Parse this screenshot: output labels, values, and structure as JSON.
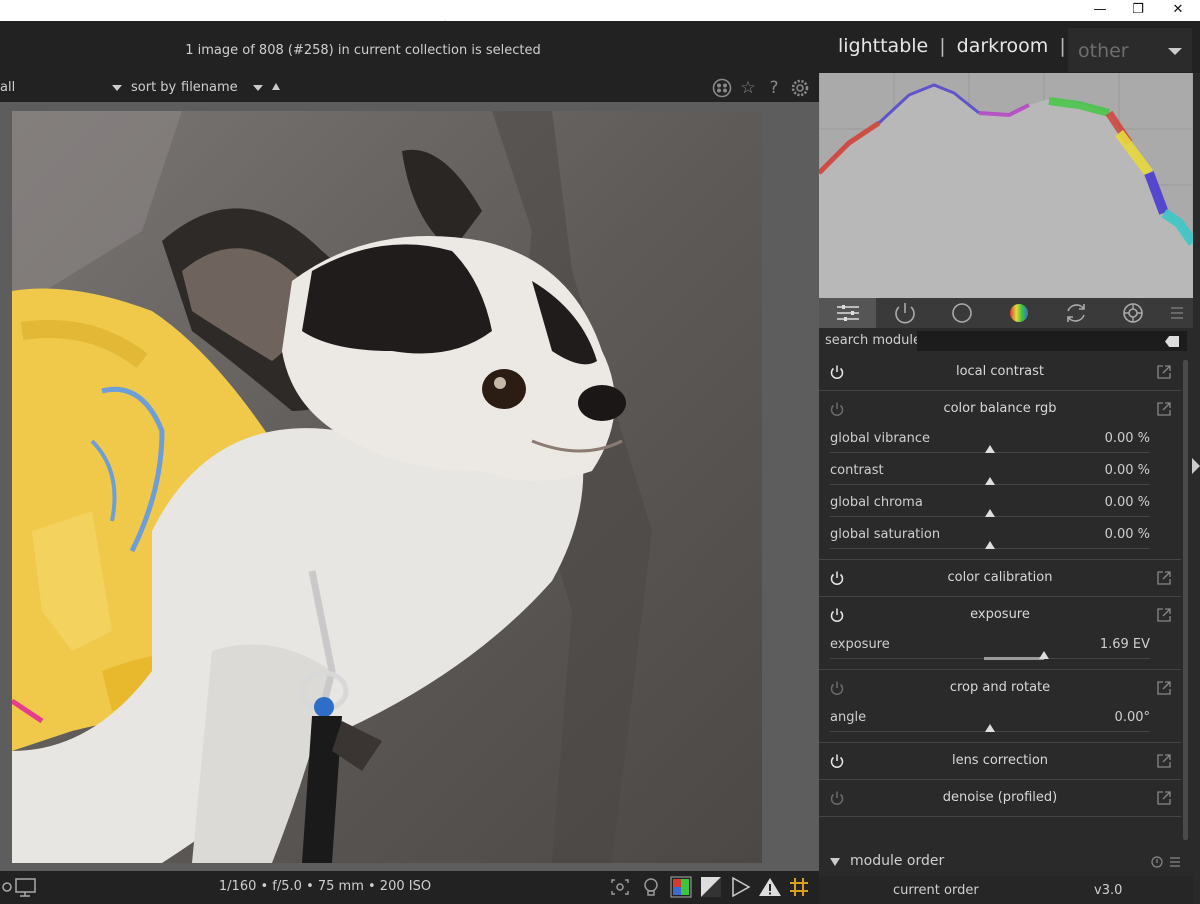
{
  "window": {
    "minimize_icon": "minimize-icon",
    "restore_icon": "restore-icon",
    "close_icon": "close-icon",
    "minimize_glyph": "—",
    "restore_glyph": "❐",
    "close_glyph": "✕"
  },
  "header": {
    "status_text": "1 image of 808 (#258) in current collection is selected",
    "views": [
      "lighttable",
      "darkroom",
      "other"
    ],
    "view_separator": "|"
  },
  "filterbar": {
    "filter_value": "all",
    "sort_label": "sort by",
    "sort_value": "filename",
    "icons": [
      "color-labels-icon",
      "star-icon",
      "help-icon",
      "preferences-icon"
    ],
    "star_glyph": "☆",
    "help_glyph": "?"
  },
  "image": {
    "subject": "chihuahua photo"
  },
  "bottombar": {
    "exif": "1/160 • f/5.0 • 75 mm • 200 ISO"
  },
  "histogram": {
    "colors": [
      "#d23c32",
      "#3c3cd2",
      "#3cc83c",
      "#e8d83c",
      "#c83cc8",
      "#3cc8c8"
    ]
  },
  "tabs": [
    "quick-access-icon",
    "active-modules-icon",
    "base-modules-icon",
    "color-modules-icon",
    "correct-modules-icon",
    "effect-modules-icon",
    "tabs-menu-icon"
  ],
  "search": {
    "label": "search module",
    "value": ""
  },
  "modules": [
    {
      "name": "local contrast",
      "enabled": true,
      "params": []
    },
    {
      "name": "color balance rgb",
      "enabled": false,
      "params": [
        {
          "label": "global vibrance",
          "value": "0.00 %",
          "position": 0.5
        },
        {
          "label": "contrast",
          "value": "0.00 %",
          "position": 0.5
        },
        {
          "label": "global chroma",
          "value": "0.00 %",
          "position": 0.5
        },
        {
          "label": "global saturation",
          "value": "0.00 %",
          "position": 0.5
        }
      ]
    },
    {
      "name": "color calibration",
      "enabled": true,
      "params": []
    },
    {
      "name": "exposure",
      "enabled": true,
      "params": [
        {
          "label": "exposure",
          "value": "1.69 EV",
          "position": 0.67,
          "fill_from": 0.48
        }
      ]
    },
    {
      "name": "crop and rotate",
      "enabled": false,
      "params": [
        {
          "label": "angle",
          "value": "0.00°",
          "position": 0.5
        }
      ]
    },
    {
      "name": "lens correction",
      "enabled": true,
      "params": []
    },
    {
      "name": "denoise (profiled)",
      "enabled": false,
      "params": []
    }
  ],
  "module_order": {
    "title": "module order",
    "current_label": "current order",
    "current_value": "v3.0"
  }
}
